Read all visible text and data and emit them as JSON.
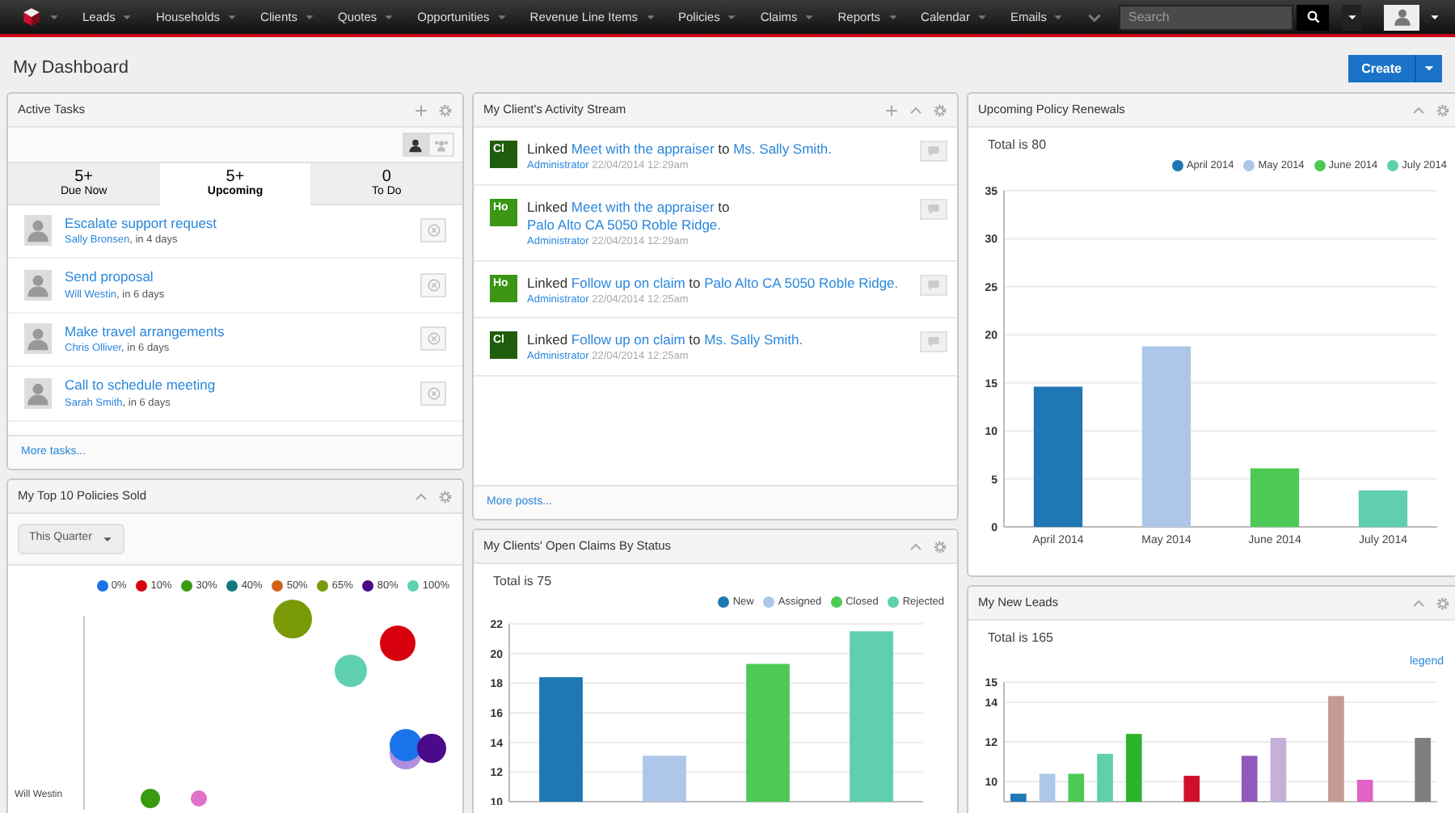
{
  "navbar": {
    "items": [
      {
        "label": "Leads"
      },
      {
        "label": "Households"
      },
      {
        "label": "Clients"
      },
      {
        "label": "Quotes"
      },
      {
        "label": "Opportunities"
      },
      {
        "label": "Revenue Line Items"
      },
      {
        "label": "Policies"
      },
      {
        "label": "Claims"
      },
      {
        "label": "Reports"
      },
      {
        "label": "Calendar"
      },
      {
        "label": "Emails"
      }
    ],
    "search": {
      "placeholder": "Search"
    }
  },
  "page_title": "My Dashboard",
  "create_button": "Create",
  "active_tasks": {
    "title": "Active Tasks",
    "filters": [
      {
        "kind": "mine",
        "selected": true
      },
      {
        "kind": "team",
        "selected": false
      }
    ],
    "tabs": [
      {
        "count": "5+",
        "label": "Due Now",
        "selected": false
      },
      {
        "count": "5+",
        "label": "Upcoming",
        "selected": true
      },
      {
        "count": "0",
        "label": "To Do",
        "selected": false
      }
    ],
    "tasks": [
      {
        "title": "Escalate support request",
        "assignee": "Sally Bronsen",
        "due": ", in 4 days"
      },
      {
        "title": "Send proposal",
        "assignee": "Will Westin",
        "due": ", in 6 days"
      },
      {
        "title": "Make travel arrangements",
        "assignee": "Chris Olliver",
        "due": ", in 6 days"
      },
      {
        "title": "Call to schedule meeting",
        "assignee": "Sarah Smith",
        "due": ", in 6 days"
      }
    ],
    "more": "More tasks..."
  },
  "activity_stream": {
    "title": "My Client's Activity Stream",
    "posts": [
      {
        "badge": "Cl",
        "color": "#1f5c0b",
        "verb": "Linked",
        "link_1": "Meet with the appraiser",
        "joiner": "to",
        "link_2": "Ms. Sally Smith.",
        "author": "Administrator",
        "time": "22/04/2014 12:29am"
      },
      {
        "badge": "Ho",
        "color": "#3a9614",
        "verb": "Linked",
        "link_1": "Meet with the appraiser",
        "joiner": "to",
        "link_2": "Palo Alto CA 5050 Roble Ridge.",
        "author": "Administrator",
        "time": "22/04/2014 12:29am"
      },
      {
        "badge": "Ho",
        "color": "#3a9614",
        "verb": "Linked",
        "link_1": "Follow up on claim",
        "joiner": "to",
        "link_2": "Palo Alto CA 5050 Roble Ridge.",
        "author": "Administrator",
        "time": "22/04/2014 12:25am"
      },
      {
        "badge": "Cl",
        "color": "#1f5c0b",
        "verb": "Linked",
        "link_1": "Follow up on claim",
        "joiner": "to",
        "link_2": "Ms. Sally Smith.",
        "author": "Administrator",
        "time": "22/04/2014 12:25am"
      }
    ],
    "more": "More posts..."
  },
  "top_policies": {
    "title": "My Top 10 Policies Sold",
    "filter": "This Quarter",
    "legend": [
      {
        "label": "0%",
        "color": "#1a73e8"
      },
      {
        "label": "10%",
        "color": "#d9000d"
      },
      {
        "label": "30%",
        "color": "#3a9a10"
      },
      {
        "label": "40%",
        "color": "#117a80"
      },
      {
        "label": "50%",
        "color": "#d2601a"
      },
      {
        "label": "65%",
        "color": "#7a9a08"
      },
      {
        "label": "80%",
        "color": "#4a0a8a"
      },
      {
        "label": "100%",
        "color": "#5fd0b0"
      }
    ],
    "axis_label": "Will Westin"
  },
  "policy_renewals": {
    "title": "Upcoming Policy Renewals",
    "total": "Total is 80",
    "chart_data": {
      "type": "bar",
      "stacked": true,
      "grid": true,
      "categories": [
        "April 2014",
        "May 2014",
        "June 2014",
        "July 2014"
      ],
      "ylim": [
        0,
        35
      ],
      "yticks": [
        0,
        5,
        10,
        15,
        20,
        25,
        30,
        35
      ],
      "series": [
        {
          "name": "April 2014",
          "color": "#1f77b4",
          "values": [
            14.6,
            null,
            null,
            null
          ]
        },
        {
          "name": "May 2014",
          "color": "#aec7e8",
          "values": [
            null,
            18.8,
            null,
            null
          ]
        },
        {
          "name": "June 2014",
          "color": "#4cca55",
          "values": [
            null,
            null,
            6.1,
            null
          ]
        },
        {
          "name": "July 2014",
          "color": "#5fcfad",
          "values": [
            null,
            null,
            null,
            3.8
          ]
        }
      ]
    }
  },
  "open_claims": {
    "title": "My Clients' Open Claims By Status",
    "total": "Total is 75",
    "chart_data": {
      "type": "bar",
      "stacked": true,
      "grid": true,
      "ylim": [
        10,
        22
      ],
      "yticks": [
        10,
        12,
        14,
        16,
        18,
        20,
        22
      ],
      "series": [
        {
          "name": "New",
          "color": "#1f77b4",
          "values": [
            18.4,
            null,
            null,
            null
          ]
        },
        {
          "name": "Assigned",
          "color": "#aec7e8",
          "values": [
            null,
            13.1,
            null,
            null
          ]
        },
        {
          "name": "Closed",
          "color": "#4cca55",
          "values": [
            null,
            null,
            19.3,
            null
          ]
        },
        {
          "name": "Rejected",
          "color": "#5fcfad",
          "values": [
            null,
            null,
            null,
            21.5
          ]
        }
      ]
    }
  },
  "new_leads": {
    "title": "My New Leads",
    "total": "Total is 165",
    "legend_link": "legend",
    "chart_data": {
      "type": "bar",
      "stacked": true,
      "grid": true,
      "ylim": [
        9,
        15
      ],
      "yticks": [
        10,
        12,
        14,
        15
      ],
      "series": [
        {
          "color": "#1f77b4",
          "values": [
            9.4,
            null,
            null,
            null,
            null,
            null,
            null,
            null,
            null,
            null,
            null,
            null,
            null,
            null,
            null
          ]
        },
        {
          "color": "#aec7e8",
          "values": [
            null,
            10.4,
            null,
            null,
            null,
            null,
            null,
            null,
            null,
            null,
            null,
            null,
            null,
            null,
            null
          ]
        },
        {
          "color": "#4cca55",
          "values": [
            null,
            null,
            10.4,
            null,
            null,
            null,
            null,
            null,
            null,
            null,
            null,
            null,
            null,
            null,
            null
          ]
        },
        {
          "color": "#5fcfad",
          "values": [
            null,
            null,
            null,
            11.4,
            null,
            null,
            null,
            null,
            null,
            null,
            null,
            null,
            null,
            null,
            null
          ]
        },
        {
          "color": "#2cb52c",
          "values": [
            null,
            null,
            null,
            null,
            12.4,
            null,
            null,
            null,
            null,
            null,
            null,
            null,
            null,
            null,
            null
          ]
        },
        {
          "color": "#d0102a",
          "values": [
            null,
            null,
            null,
            null,
            null,
            null,
            10.3,
            null,
            null,
            null,
            null,
            null,
            null,
            null,
            null
          ]
        },
        {
          "color": "#9159bf",
          "values": [
            null,
            null,
            null,
            null,
            null,
            null,
            null,
            null,
            11.3,
            null,
            null,
            null,
            null,
            null,
            null
          ]
        },
        {
          "color": "#c5b0d8",
          "values": [
            null,
            null,
            null,
            null,
            null,
            null,
            null,
            null,
            null,
            12.2,
            null,
            null,
            null,
            null,
            null
          ]
        },
        {
          "color": "#c49c94",
          "values": [
            null,
            null,
            null,
            null,
            null,
            null,
            null,
            null,
            null,
            null,
            null,
            14.3,
            null,
            null,
            null
          ]
        },
        {
          "color": "#e063c5",
          "values": [
            null,
            null,
            null,
            null,
            null,
            null,
            null,
            null,
            null,
            null,
            null,
            null,
            10.1,
            null,
            null
          ]
        },
        {
          "color": "#7f7f7f",
          "values": [
            null,
            null,
            null,
            null,
            null,
            null,
            null,
            null,
            null,
            null,
            null,
            null,
            null,
            null,
            12.2
          ]
        }
      ]
    }
  }
}
